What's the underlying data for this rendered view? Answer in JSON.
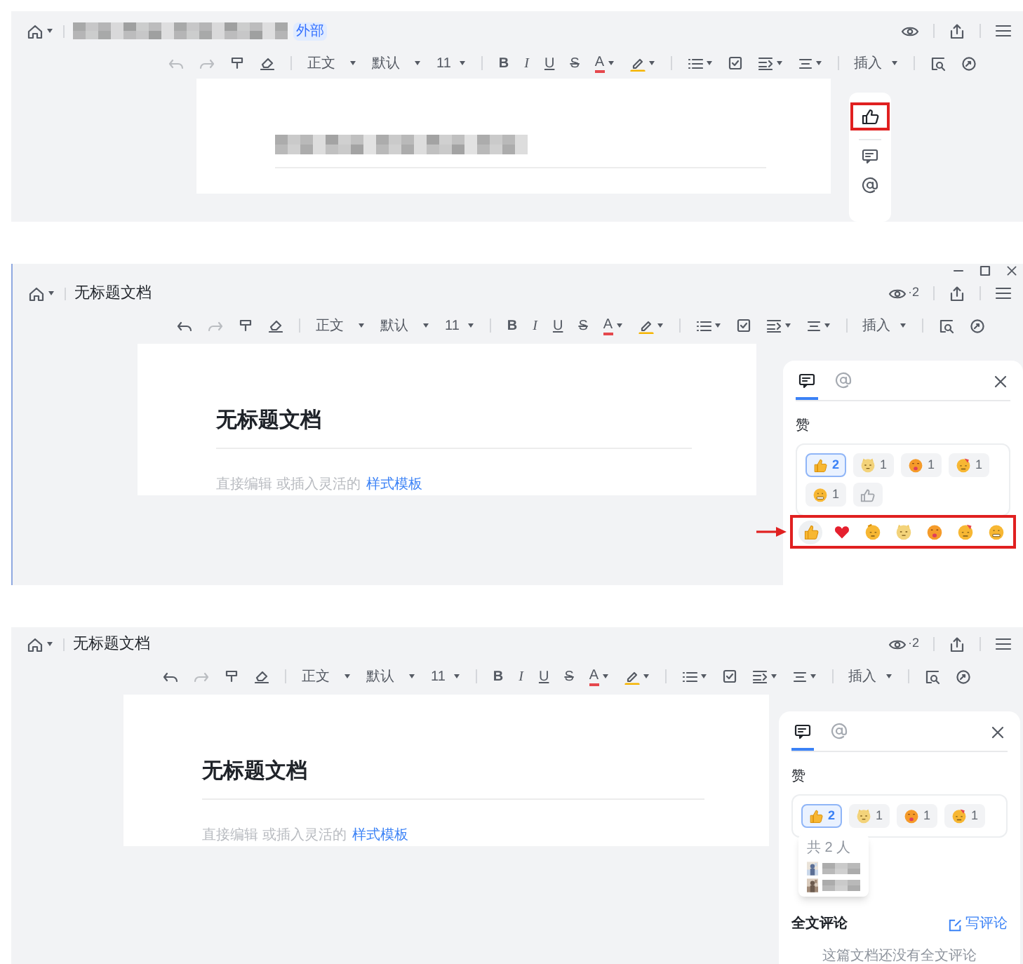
{
  "views": [
    {
      "kind": "rail",
      "header": {
        "title_redacted": true,
        "badge": "外部"
      },
      "toolbar": {
        "undo_enabled": false,
        "style": "正文",
        "font": "默认",
        "size": "11",
        "bold": "B",
        "italic": "I",
        "underline": "U",
        "strike": "S",
        "font_color": "A",
        "insert": "插入"
      },
      "doc": {
        "title_redacted": true
      },
      "rail": {
        "like_highlighted": true
      }
    },
    {
      "kind": "comments",
      "window_controls": true,
      "header": {
        "title": "无标题文档",
        "viewers": "·2"
      },
      "toolbar": {
        "undo_enabled": true,
        "style": "正文",
        "font": "默认",
        "size": "11",
        "bold": "B",
        "italic": "I",
        "underline": "U",
        "strike": "S",
        "font_color": "A",
        "insert": "插入"
      },
      "doc": {
        "title": "无标题文档",
        "hint": "直接编辑 或插入灵活的",
        "hint_link": "样式模板"
      },
      "panel": {
        "tabs": [
          {
            "kind": "comment",
            "selected": true
          },
          {
            "kind": "mention",
            "selected": false
          }
        ],
        "section": "赞",
        "reactions": [
          {
            "kind": "thumbs_up",
            "count": "2",
            "selected": true
          },
          {
            "kind": "cat",
            "count": "1",
            "selected": false
          },
          {
            "kind": "tongue",
            "count": "1",
            "selected": false
          },
          {
            "kind": "party",
            "count": "1",
            "selected": false
          },
          {
            "kind": "grimace",
            "count": "1",
            "selected": false
          }
        ],
        "emoji_picker": {
          "highlighted": true,
          "emojis": [
            {
              "kind": "thumbs_up",
              "selected": true
            },
            {
              "kind": "heart",
              "selected": false
            },
            {
              "kind": "salute",
              "selected": false
            },
            {
              "kind": "cat",
              "selected": false
            },
            {
              "kind": "tongue",
              "selected": false
            },
            {
              "kind": "party",
              "selected": false
            },
            {
              "kind": "grimace",
              "selected": false
            }
          ]
        }
      }
    },
    {
      "kind": "comments",
      "header": {
        "title": "无标题文档",
        "viewers": "·2"
      },
      "toolbar": {
        "undo_enabled": true,
        "style": "正文",
        "font": "默认",
        "size": "11",
        "bold": "B",
        "italic": "I",
        "underline": "U",
        "strike": "S",
        "font_color": "A",
        "insert": "插入"
      },
      "doc": {
        "title": "无标题文档",
        "hint": "直接编辑 或插入灵活的",
        "hint_link": "样式模板"
      },
      "panel": {
        "tabs": [
          {
            "kind": "comment",
            "selected": true
          },
          {
            "kind": "mention",
            "selected": false
          }
        ],
        "section": "赞",
        "reactions": [
          {
            "kind": "thumbs_up",
            "count": "2",
            "selected": true
          },
          {
            "kind": "cat",
            "count": "1",
            "selected": false
          },
          {
            "kind": "tongue",
            "count": "1",
            "selected": false
          },
          {
            "kind": "party",
            "count": "1",
            "selected": false
          }
        ],
        "tooltip": {
          "summary": "共 2 人"
        },
        "full_comments": {
          "title": "全文评论",
          "action": "写评论",
          "empty": "这篇文档还没有全文评论"
        }
      }
    }
  ]
}
